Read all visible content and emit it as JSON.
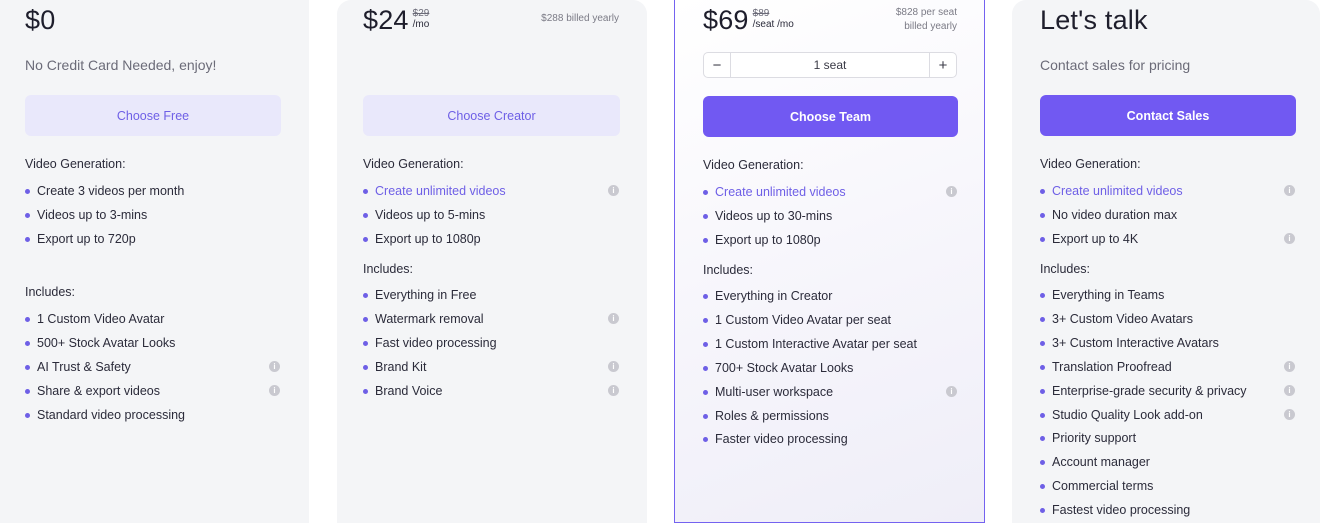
{
  "free": {
    "price": "$0",
    "subtitle": "No Credit Card Needed, enjoy!",
    "button": "Choose Free",
    "section1": "Video Generation:",
    "gen": [
      "Create 3 videos per month",
      "Videos up to 3-mins",
      "Export up to 720p"
    ],
    "section2": "Includes:",
    "includes": [
      "1 Custom Video Avatar",
      "500+ Stock Avatar Looks",
      "AI Trust & Safety",
      "Share & export videos",
      "Standard video processing"
    ]
  },
  "creator": {
    "price": "$24",
    "old_price": "$29",
    "per": "/mo",
    "billed": "$288 billed yearly",
    "button": "Choose Creator",
    "section1": "Video Generation:",
    "gen": [
      "Create unlimited videos",
      "Videos up to 5-mins",
      "Export up to 1080p"
    ],
    "section2": "Includes:",
    "includes": [
      "Everything in Free",
      "Watermark removal",
      "Fast video processing",
      "Brand Kit",
      "Brand Voice"
    ]
  },
  "team": {
    "price": "$69",
    "old_price": "$89",
    "per": "/seat /mo",
    "billed_line1": "$828 per seat",
    "billed_line2": "billed yearly",
    "seat_minus": "−",
    "seat_value": "1 seat",
    "seat_plus": "+",
    "button": "Choose Team",
    "section1": "Video Generation:",
    "gen": [
      "Create unlimited videos",
      "Videos up to 30-mins",
      "Export up to 1080p"
    ],
    "section2": "Includes:",
    "includes": [
      "Everything in Creator",
      "1 Custom Video Avatar per seat",
      "1 Custom Interactive Avatar per seat",
      "700+ Stock Avatar Looks",
      "Multi-user workspace",
      "Roles & permissions",
      "Faster video processing"
    ]
  },
  "enterprise": {
    "title": "Let's talk",
    "subtitle": "Contact sales for pricing",
    "button": "Contact Sales",
    "section1": "Video Generation:",
    "gen": [
      "Create unlimited videos",
      "No video duration max",
      "Export up to 4K"
    ],
    "section2": "Includes:",
    "includes": [
      "Everything in Teams",
      "3+ Custom Video Avatars",
      "3+ Custom Interactive Avatars",
      "Translation Proofread",
      "Enterprise-grade security & privacy",
      "Studio Quality Look add-on",
      "Priority support",
      "Account manager",
      "Commercial terms",
      "Fastest video processing"
    ]
  },
  "colors": {
    "accent": "#7159f2",
    "accent_light": "#e9e8fb",
    "card_bg": "#f4f5f7"
  },
  "icons": {
    "info": "info-icon",
    "bullet": "bullet-dot"
  }
}
